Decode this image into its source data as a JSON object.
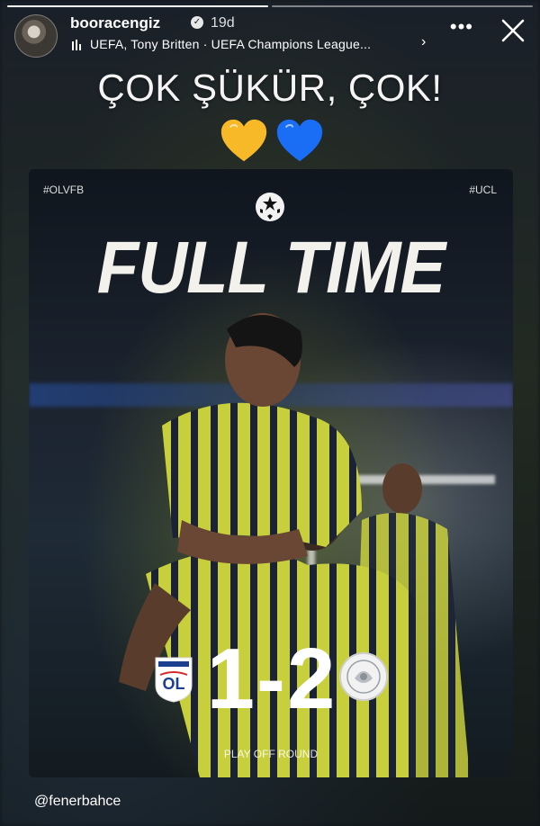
{
  "story": {
    "username": "booracengiz",
    "time": "19d",
    "music": "UEFA, Tony Britten · UEFA Champions League...",
    "caption": "ÇOK ŞÜKÜR, ÇOK!",
    "mention": "@fenerbahce",
    "progress_segments": 2,
    "active_segment": 1
  },
  "card": {
    "tag_left": "#OLVFB",
    "tag_right": "#UCL",
    "headline": "FULL TIME",
    "home_score": "1",
    "away_score": "2",
    "score_text": "1-2",
    "round": "PLAY OFF ROUND",
    "home_crest_text": "OL",
    "home_crest_small": "OLYMPIQUE LYONNAIS"
  },
  "colors": {
    "heart_yellow": "#f7b928",
    "heart_blue": "#1a6ef5",
    "kit_yellow": "#c8cf3c",
    "kit_navy": "#1b2236"
  }
}
